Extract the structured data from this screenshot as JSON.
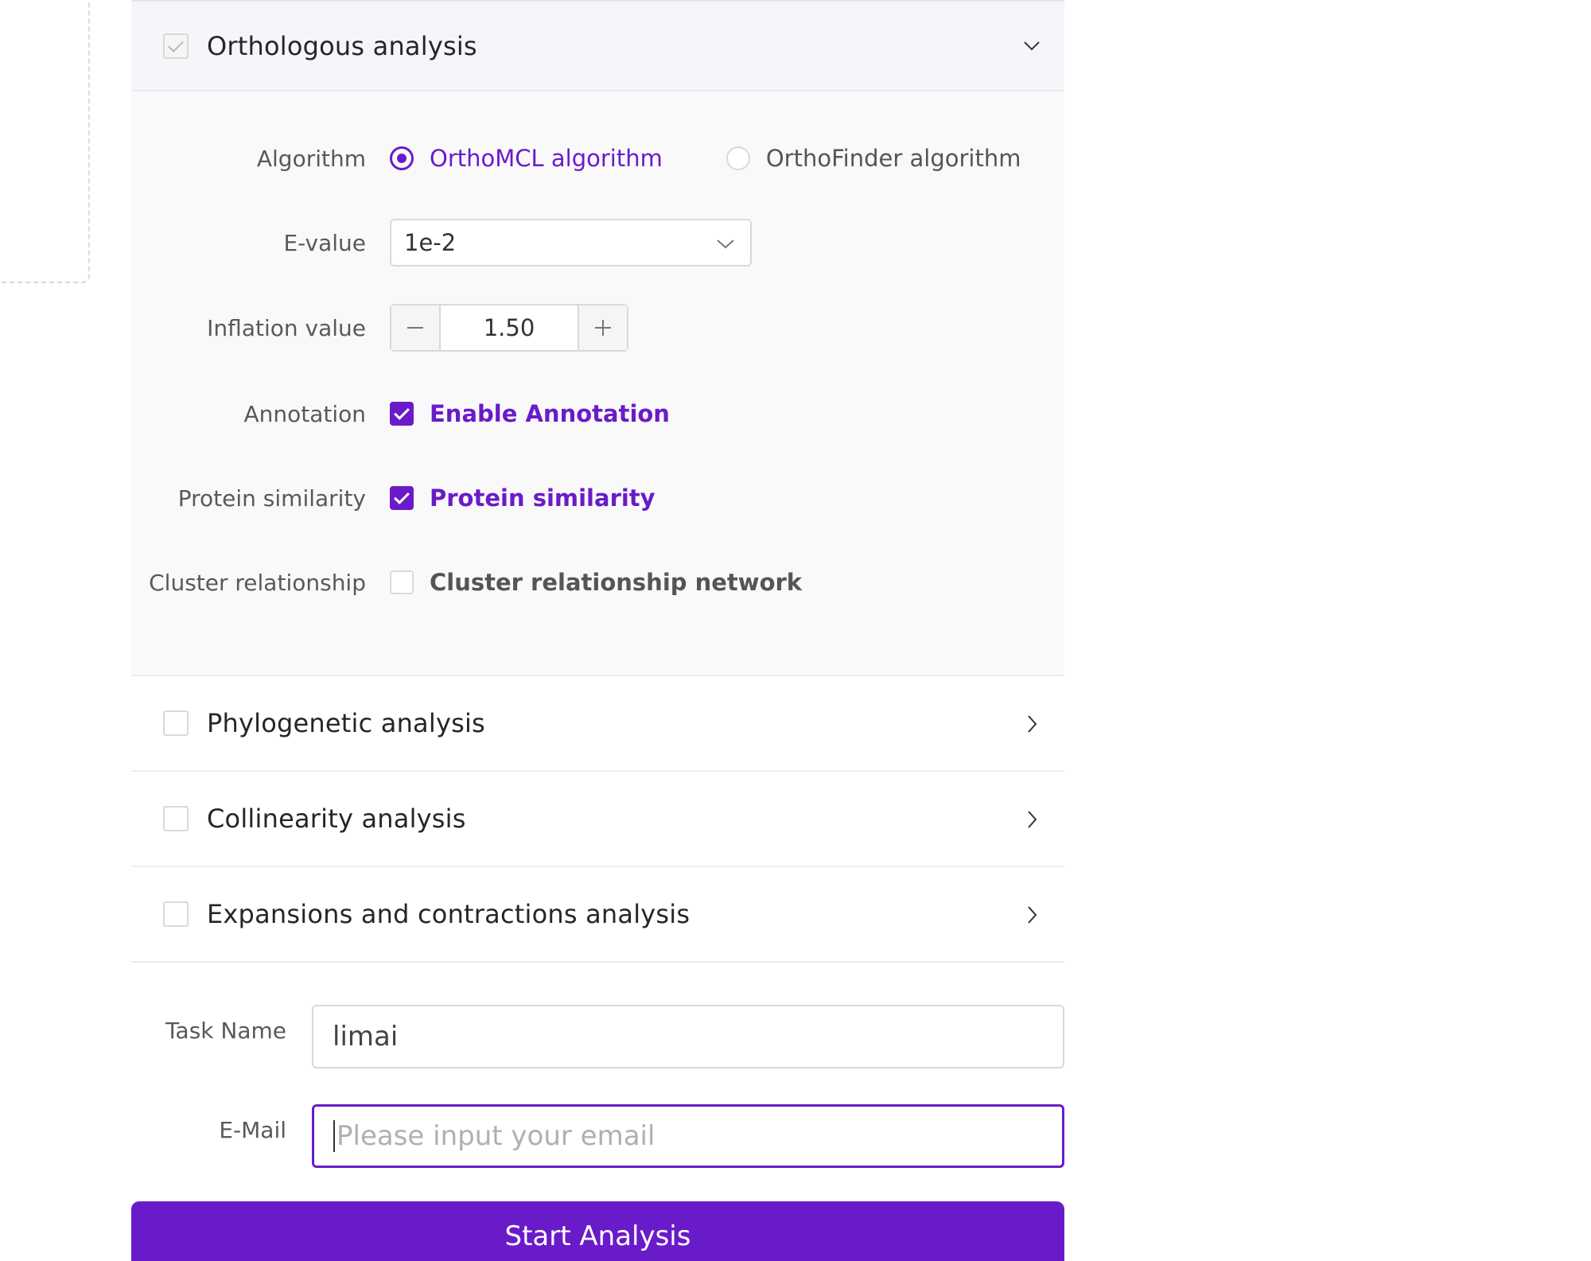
{
  "sections": {
    "orthologous": {
      "title": "Orthologous analysis",
      "algorithm_label": "Algorithm",
      "algorithm_options": [
        "OrthoMCL algorithm",
        "OrthoFinder algorithm"
      ],
      "algorithm_selected": "OrthoMCL algorithm",
      "evalue_label": "E-value",
      "evalue_value": "1e-2",
      "inflation_label": "Inflation value",
      "inflation_value": "1.50",
      "annotation_label": "Annotation",
      "annotation_option": "Enable Annotation",
      "protein_label": "Protein similarity",
      "protein_option": "Protein similarity",
      "cluster_label": "Cluster relationship",
      "cluster_option": "Cluster relationship network"
    },
    "phylogenetic": {
      "title": "Phylogenetic analysis"
    },
    "collinearity": {
      "title": "Collinearity analysis"
    },
    "expansions": {
      "title": "Expansions and contractions analysis"
    }
  },
  "form": {
    "task_name_label": "Task Name",
    "task_name_value": "limai",
    "email_label": "E-Mail",
    "email_placeholder": "Please input your email"
  },
  "actions": {
    "start_label": "Start Analysis"
  },
  "icons": {
    "section_open": "chevron-down-icon",
    "section_closed": "chevron-right-icon",
    "select": "chevron-down-icon",
    "minus": "minus-icon",
    "plus": "plus-icon"
  },
  "colors": {
    "accent": "#6a1bc9",
    "section_bg": "#f5f6fa",
    "body_bg": "#f9f9fa",
    "border": "#d9d9d9"
  }
}
